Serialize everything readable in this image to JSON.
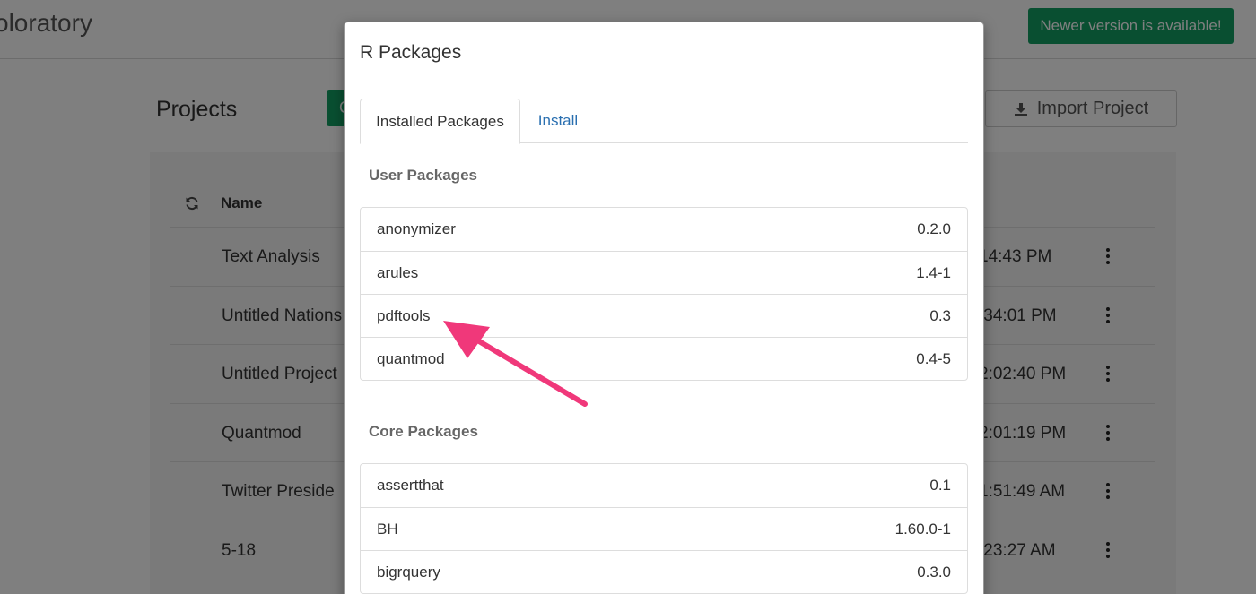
{
  "app": {
    "title": "oloratory",
    "newer_version_label": "Newer version is available!",
    "projects_title": "Projects",
    "create_label": "C",
    "import_label": "Import Project",
    "table_name_header": "Name",
    "projects": [
      {
        "name": "Text Analysis",
        "time": "14:43 PM"
      },
      {
        "name": "Untitled Nations",
        "time": ":34:01 PM"
      },
      {
        "name": "Untitled Project",
        "time": "2:02:40 PM"
      },
      {
        "name": "Quantmod",
        "time": "2:01:19 PM"
      },
      {
        "name": "Twitter Preside",
        "time": "1:51:49 AM"
      },
      {
        "name": "5-18",
        "time": ":23:27 AM"
      }
    ]
  },
  "modal": {
    "title": "R Packages",
    "tabs": [
      {
        "label": "Installed Packages",
        "active": true
      },
      {
        "label": "Install",
        "active": false
      }
    ],
    "user_packages_title": "User Packages",
    "user_packages": [
      {
        "name": "anonymizer",
        "version": "0.2.0"
      },
      {
        "name": "arules",
        "version": "1.4-1"
      },
      {
        "name": "pdftools",
        "version": "0.3"
      },
      {
        "name": "quantmod",
        "version": "0.4-5"
      }
    ],
    "core_packages_title": "Core Packages",
    "core_packages": [
      {
        "name": "assertthat",
        "version": "0.1"
      },
      {
        "name": "BH",
        "version": "1.60.0-1"
      },
      {
        "name": "bigrquery",
        "version": "0.3.0"
      }
    ]
  },
  "colors": {
    "accent_green": "#139e63",
    "link_blue": "#2a6fb0",
    "annotation_arrow": "#f0387a"
  }
}
